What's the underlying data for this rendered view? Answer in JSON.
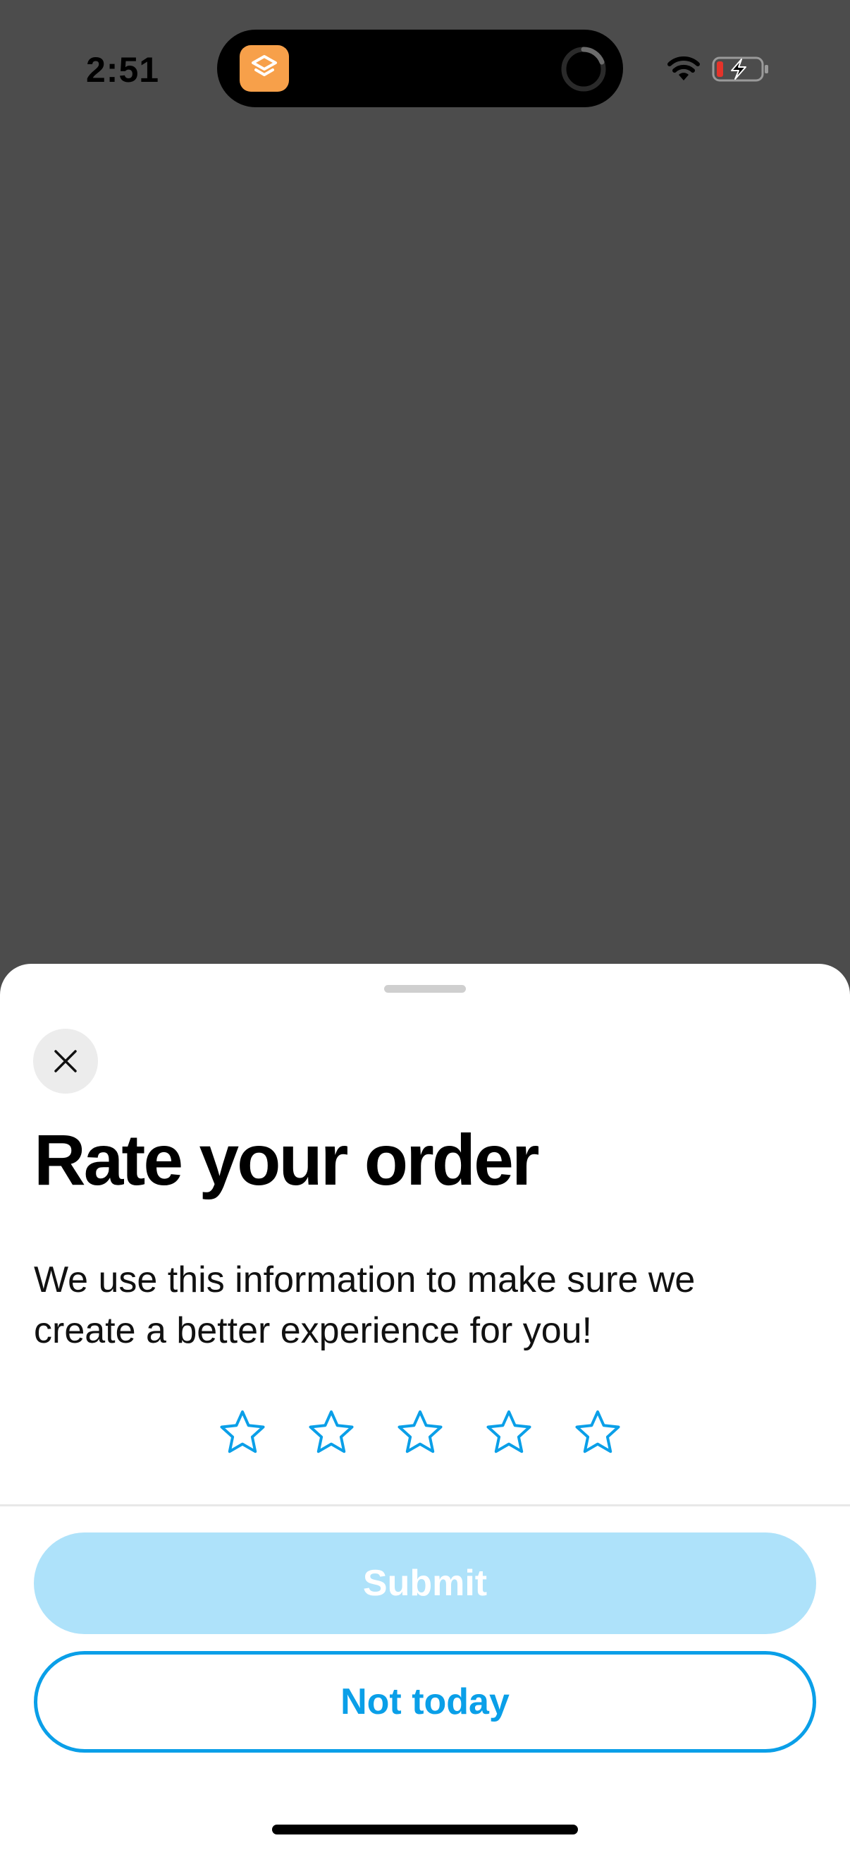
{
  "status_bar": {
    "time": "2:51",
    "app_icon": "shortcuts-app-icon",
    "activity_icon": "loading-spinner-icon",
    "wifi_icon": "wifi-icon",
    "battery_icon": "battery-charging-icon",
    "battery_color": "#e5332a"
  },
  "sheet": {
    "close_icon": "close-icon",
    "title": "Rate your order",
    "description": "We use this information to make sure we create a better experience for you!",
    "rating": {
      "max": 5,
      "selected": 0,
      "star_icon": "star-outline-icon",
      "star_color": "#0a9fe8"
    },
    "submit_label": "Submit",
    "submit_enabled": false,
    "not_today_label": "Not today"
  },
  "colors": {
    "accent": "#0a9fe8",
    "submit_disabled_bg": "#aee2fa",
    "overlay": "#4c4c4c"
  }
}
